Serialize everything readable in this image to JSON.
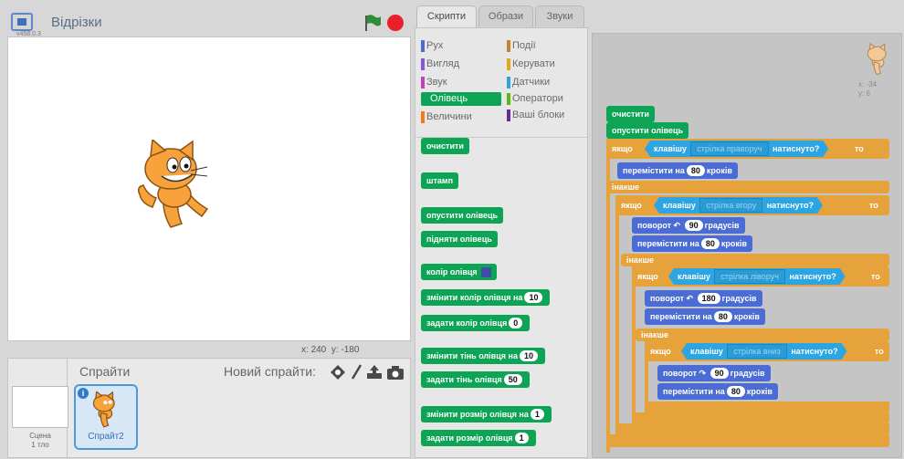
{
  "stage": {
    "title": "Відрізки",
    "version": "v458.0.3",
    "coords_x_label": "x:",
    "coords_x": "240",
    "coords_y_label": "y:",
    "coords_y": "-180"
  },
  "sprites_panel": {
    "title": "Спрайти",
    "new_sprite_label": "Новий спрайти:",
    "stage_label_line1": "Сцена",
    "stage_label_line2": "1 тло",
    "sprite_name": "Спрайт2",
    "info_badge": "i"
  },
  "tabs": [
    {
      "label": "Скрипти",
      "active": true
    },
    {
      "label": "Образи",
      "active": false
    },
    {
      "label": "Звуки",
      "active": false
    }
  ],
  "categories": [
    {
      "label": "Рух",
      "color": "#4a6cd4"
    },
    {
      "label": "Події",
      "color": "#c88330"
    },
    {
      "label": "Вигляд",
      "color": "#8a55d7"
    },
    {
      "label": "Керувати",
      "color": "#e1a91a"
    },
    {
      "label": "Звук",
      "color": "#bb42c3"
    },
    {
      "label": "Датчики",
      "color": "#2ca5e2"
    },
    {
      "label": "Олівець",
      "color": "#0ea455",
      "active": true
    },
    {
      "label": "Оператори",
      "color": "#5cb712"
    },
    {
      "label": "Величини",
      "color": "#ee7d16"
    },
    {
      "label": "Ваші блоки",
      "color": "#632d99"
    }
  ],
  "palette_blocks": {
    "clear": "очистити",
    "stamp": "штамп",
    "pen_down": "опустити олівець",
    "pen_up": "підняти олівець",
    "set_color": "колір олівця",
    "change_color": "змінити колір олівця на",
    "change_color_val": "10",
    "set_color_to": "задати колір олівця",
    "set_color_to_val": "0",
    "change_shade": "змінити тінь олівця на",
    "change_shade_val": "10",
    "set_shade": "задати тінь олівця",
    "set_shade_val": "50",
    "change_size": "змінити розмір олівця на",
    "change_size_val": "1",
    "set_size": "задати розмір олівця",
    "set_size_val": "1"
  },
  "script": {
    "clear": "очистити",
    "pen_down": "опустити олівець",
    "if_label": "якщо",
    "then_label": "то",
    "else_label": "інакше",
    "key_label": "клавішу",
    "pressed_label": "натиснуто?",
    "key1": "стрілка праворуч",
    "key2": "стрілка вгору",
    "key3": "стрілка ліворуч",
    "key4": "стрілка вниз",
    "move_label": "перемістити на",
    "steps_label": "кроків",
    "move_val": "80",
    "turn_label": "поворот",
    "degrees_label": "градусів",
    "turn1_val": "90",
    "turn2_val": "180",
    "turn3_val": "90"
  },
  "sprite_info": {
    "x_label": "x:",
    "x": "-34",
    "y_label": "y:",
    "y": "6"
  },
  "colors": {
    "pen": "#0ea455",
    "motion": "#4a6cd4",
    "control": "#e6a23b",
    "sensing": "#2ca5e2",
    "stage_bg": "#ffffff",
    "accent_red": "#e8202a",
    "flag_green": "#2f8c3b"
  },
  "icons": [
    "fullscreen-icon",
    "green-flag-icon",
    "stop-icon",
    "paint-sprite-icon",
    "brush-icon",
    "upload-icon",
    "camera-icon",
    "info-icon",
    "cat-sprite"
  ]
}
